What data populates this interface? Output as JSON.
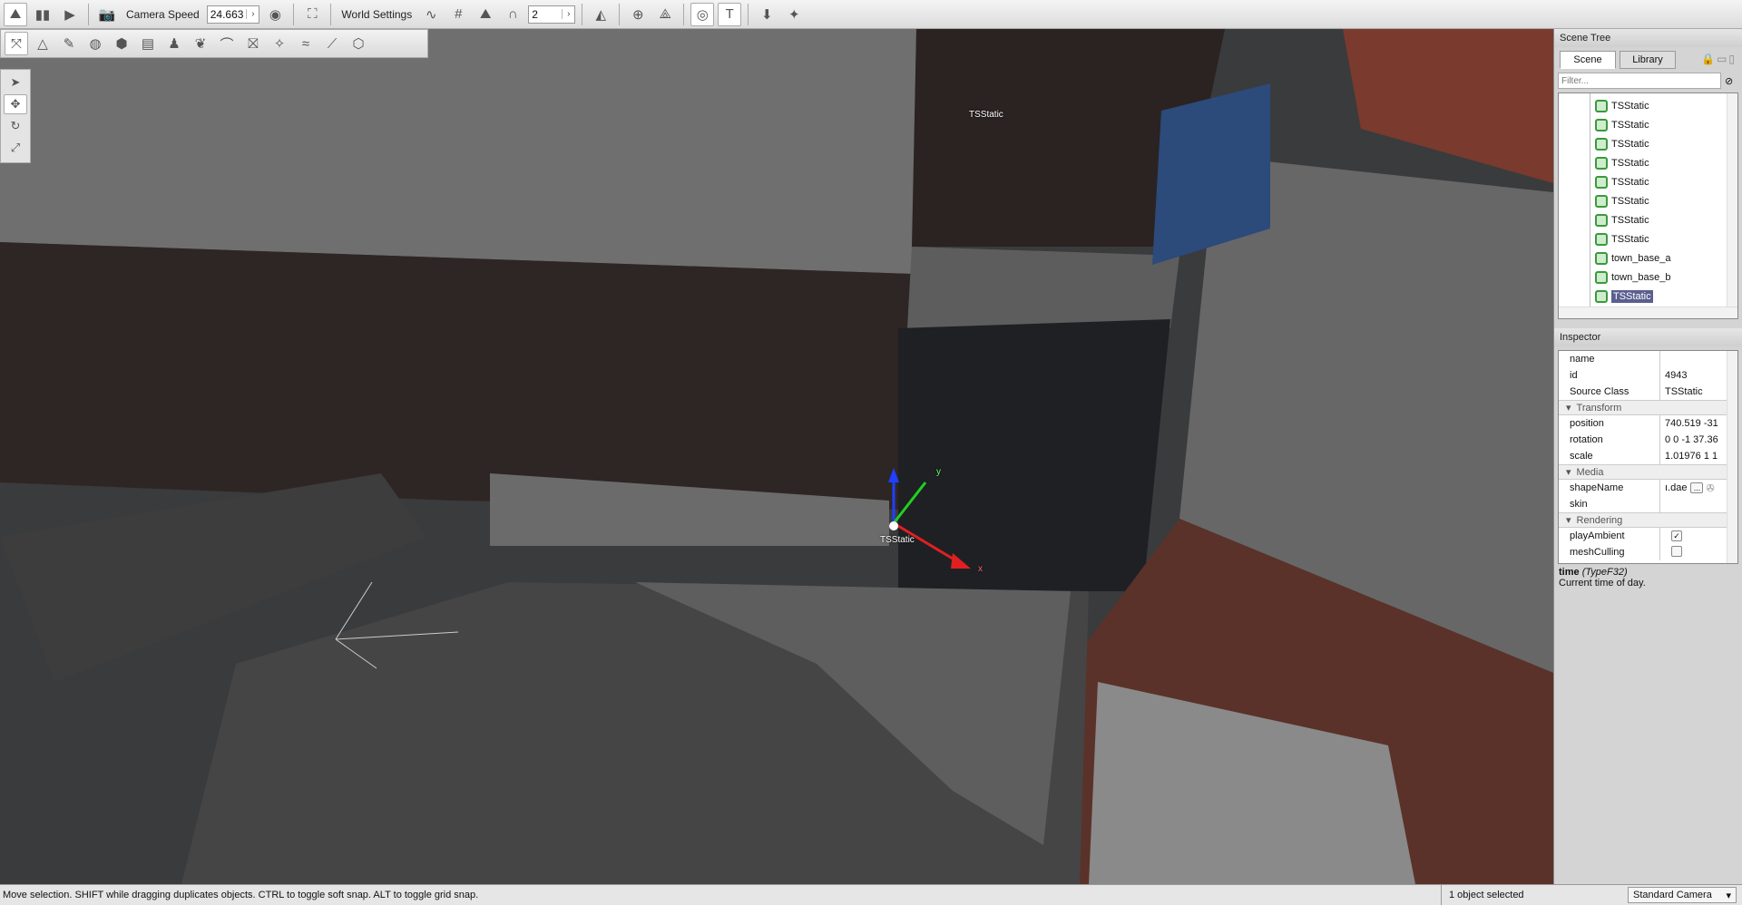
{
  "toolbar": {
    "camera_speed_label": "Camera Speed",
    "camera_speed_value": "24.663",
    "world_settings_label": "World Settings",
    "grid_value": "2"
  },
  "viewport": {
    "object_label_1": "TSStatic",
    "object_label_2": "TSStatic",
    "gizmo_y": "y",
    "gizmo_x": "x"
  },
  "scene_tree": {
    "title": "Scene Tree",
    "tabs": [
      "Scene",
      "Library"
    ],
    "filter_placeholder": "Filter...",
    "items": [
      "TSStatic",
      "TSStatic",
      "TSStatic",
      "TSStatic",
      "TSStatic",
      "TSStatic",
      "TSStatic",
      "TSStatic",
      "town_base_a",
      "town_base_b",
      "TSStatic"
    ],
    "selected_index": 10
  },
  "inspector": {
    "title": "Inspector",
    "fields": {
      "name": {
        "label": "name",
        "value": ""
      },
      "id": {
        "label": "id",
        "value": "4943"
      },
      "source_class": {
        "label": "Source Class",
        "value": "TSStatic"
      }
    },
    "transform": {
      "label": "Transform",
      "position": {
        "label": "position",
        "value": "740.519 -31"
      },
      "rotation": {
        "label": "rotation",
        "value": "0 0 -1 37.36"
      },
      "scale": {
        "label": "scale",
        "value": "1.01976 1 1"
      }
    },
    "media": {
      "label": "Media",
      "shape_name": {
        "label": "shapeName",
        "value": "ı.dae"
      },
      "skin": {
        "label": "skin",
        "value": ""
      },
      "browse": "..."
    },
    "rendering": {
      "label": "Rendering",
      "play_ambient": {
        "label": "playAmbient",
        "checked": true
      },
      "mesh_culling": {
        "label": "meshCulling",
        "checked": false
      }
    },
    "help_title": "time",
    "help_type": "(TypeF32)",
    "help_text": "Current time of day."
  },
  "status": {
    "message": "Move selection.  SHIFT while dragging duplicates objects.  CTRL to toggle soft snap.  ALT to toggle grid snap.",
    "selection": "1 object selected",
    "camera": "Standard Camera"
  }
}
